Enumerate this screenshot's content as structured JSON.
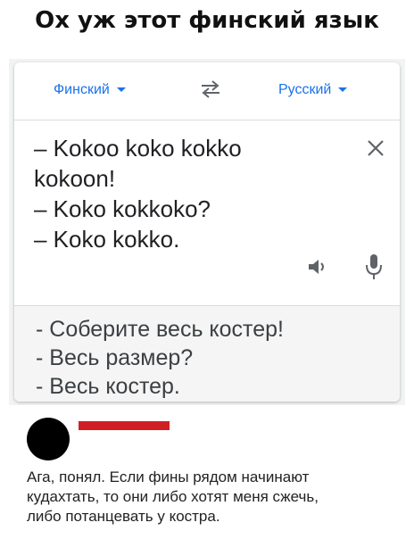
{
  "meme": {
    "title": "Ох уж этот финский язык"
  },
  "translator": {
    "source_language": "Финский",
    "target_language": "Русский",
    "source_lines": [
      "– Kokoo koko kokko",
      "kokoon!",
      "– Koko kokkoko?",
      "– Koko kokko."
    ],
    "result_lines": [
      "- Соберите весь костер!",
      "- Весь размер?",
      "- Весь костер."
    ],
    "icons": {
      "swap": "swap-arrows-icon",
      "clear": "close-icon",
      "speaker": "speaker-icon",
      "mic": "microphone-icon"
    },
    "colors": {
      "accent": "#1a73e8",
      "result_background": "#f5f5f5"
    }
  },
  "comment": {
    "lines": [
      "Ага, понял. Если фины рядом начинают",
      "кудахтать, то они либо хотят меня сжечь,",
      "либо потанцевать у костра."
    ],
    "colors": {
      "avatar": "#000000",
      "name_redaction": "#d11f26"
    }
  }
}
